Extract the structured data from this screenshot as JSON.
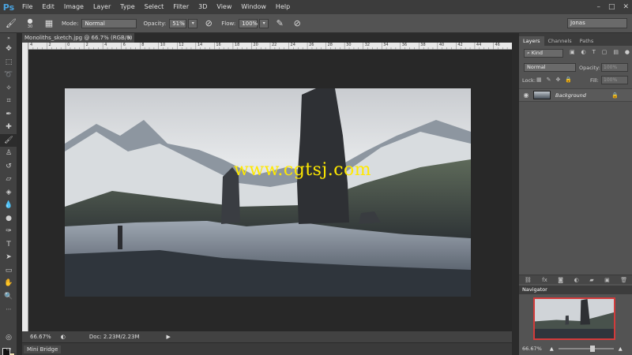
{
  "app": {
    "logo": "Ps"
  },
  "menu": [
    "File",
    "Edit",
    "Image",
    "Layer",
    "Type",
    "Select",
    "Filter",
    "3D",
    "View",
    "Window",
    "Help"
  ],
  "window_controls": [
    "–",
    "□",
    "✕"
  ],
  "options_bar": {
    "brush_size": "30",
    "mode_label": "Mode:",
    "mode_value": "Normal",
    "opacity_label": "Opacity:",
    "opacity_value": "51%",
    "flow_label": "Flow:",
    "flow_value": "100%",
    "workspace": "Jonas"
  },
  "document": {
    "tab_title": "Monoliths_sketch.jpg @ 66.7% (RGB/8)",
    "tab_close": "×",
    "ruler_marks": [
      "4",
      "2",
      "0",
      "2",
      "4",
      "6",
      "8",
      "10",
      "12",
      "14",
      "16",
      "18",
      "20",
      "22",
      "24",
      "26",
      "28",
      "30",
      "32",
      "34",
      "36",
      "38",
      "40",
      "42",
      "44",
      "46"
    ],
    "watermark": "www.cgtsj.com"
  },
  "status_bar": {
    "zoom": "66.67%",
    "doc_info": "Doc: 2.23M/2.23M"
  },
  "mini_bridge": {
    "label": "Mini Bridge"
  },
  "layers_panel": {
    "tabs": [
      "Layers",
      "Channels",
      "Paths"
    ],
    "kind_filter": "Kind",
    "blend_mode": "Normal",
    "opacity_label": "Opacity:",
    "opacity_value": "100%",
    "lock_label": "Lock:",
    "fill_label": "Fill:",
    "fill_value": "100%",
    "layer": {
      "name": "Background"
    }
  },
  "navigator": {
    "title": "Navigator",
    "zoom": "66.67%"
  },
  "colors": {
    "accent": "#4aa3df",
    "watermark": "#ffe900",
    "navigator_frame": "#d23b3b"
  }
}
